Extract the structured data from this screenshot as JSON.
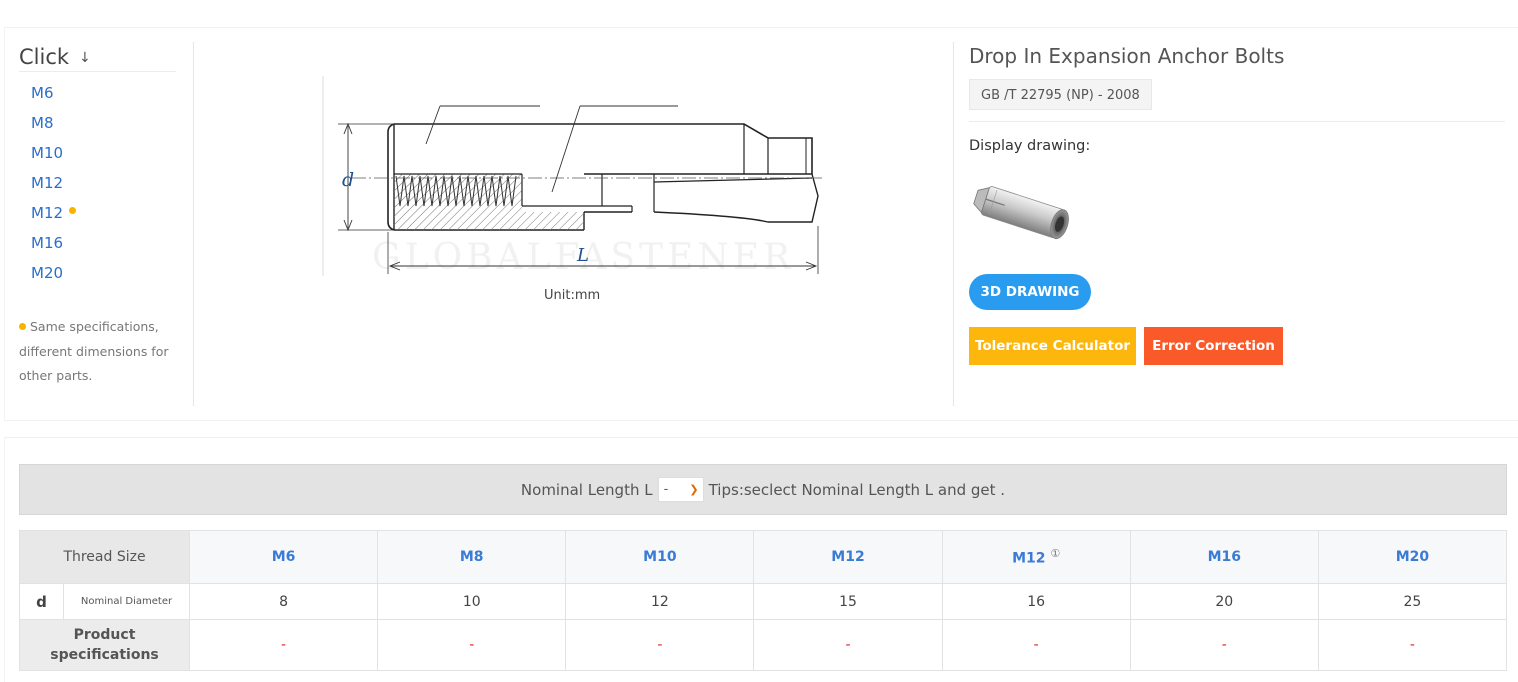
{
  "sidebar": {
    "title": "Click",
    "arrow": "↓",
    "items": [
      {
        "label": "M6",
        "dot": false
      },
      {
        "label": "M8",
        "dot": false
      },
      {
        "label": "M10",
        "dot": false
      },
      {
        "label": "M12",
        "dot": false
      },
      {
        "label": "M12",
        "dot": true
      },
      {
        "label": "M16",
        "dot": false
      },
      {
        "label": "M20",
        "dot": false
      }
    ],
    "note": "Same specifications, different dimensions for other parts."
  },
  "drawing": {
    "label_d": "d",
    "label_L": "L",
    "watermark": "GLOBALFASTENER",
    "unit": "Unit:mm"
  },
  "product": {
    "title": "Drop In Expansion Anchor Bolts",
    "standard": "GB /T 22795 (NP) - 2008",
    "display_label": "Display drawing:",
    "btn_3d": "3D DRAWING",
    "btn_tolerance": "Tolerance Calculator",
    "btn_error": "Error Correction"
  },
  "filter": {
    "label": "Nominal Length L",
    "selected": "-",
    "tip": "Tips:seclect Nominal Length L and get ."
  },
  "table": {
    "thread_label": "Thread Size",
    "columns": [
      "M6",
      "M8",
      "M10",
      "M12",
      "M12",
      "M16",
      "M20"
    ],
    "col5_sup": "①",
    "d_symbol": "d",
    "d_name": "Nominal Diameter",
    "d_values": [
      "8",
      "10",
      "12",
      "15",
      "16",
      "20",
      "25"
    ],
    "spec_label": "Product specifications",
    "spec_values": [
      "-",
      "-",
      "-",
      "-",
      "-",
      "-",
      "-"
    ]
  },
  "colors": {
    "link": "#2a6ecb",
    "dot": "#f6b400",
    "btn_3d": "#2a9cf0",
    "btn_tolerance": "#fdb60c",
    "btn_error": "#fa5a2a",
    "dash": "#d22"
  }
}
